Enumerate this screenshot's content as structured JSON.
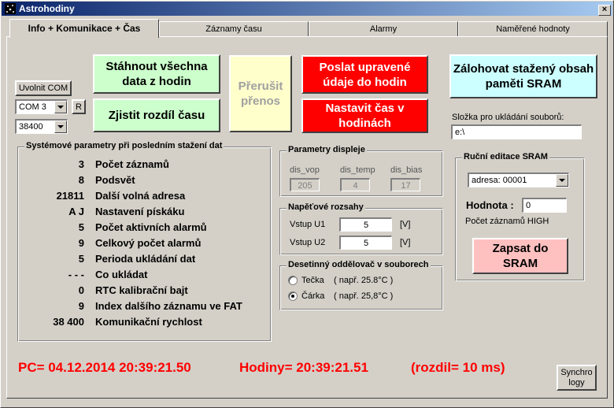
{
  "window": {
    "title": "Astrohodiny",
    "close_label": "×"
  },
  "tabs": [
    {
      "label": "Info + Komunikace + Čas",
      "active": true
    },
    {
      "label": "Záznamy času"
    },
    {
      "label": "Alarmy"
    },
    {
      "label": "Naměřené hodnoty"
    }
  ],
  "connection": {
    "release_label": "Uvolnit COM",
    "port_value": "COM 3",
    "refresh_label": "R",
    "baud_value": "38400"
  },
  "actions": {
    "download_label": "Stáhnout všechna data z hodin",
    "diff_label": "Zjistit rozdíl času",
    "abort_label": "Přerušit přenos",
    "send_label": "Poslat upravené údaje do hodin",
    "settime_label": "Nastavit čas v hodinách",
    "backup_label": "Zálohovat stažený obsah paměti SRAM",
    "write_label": "Zapsat do SRAM",
    "synchro_label": "Synchro logy"
  },
  "save_folder": {
    "label": "Složka pro ukládání souborů:",
    "value": "e:\\"
  },
  "system_params": {
    "title": "Systémové parametry při posledním stažení dat",
    "rows": [
      {
        "value": "3",
        "label": "Počet záznamů"
      },
      {
        "value": "8",
        "label": "Podsvět"
      },
      {
        "value": "21811",
        "label": "Další volná adresa"
      },
      {
        "value": "A J",
        "label": "Nastavení pískáku"
      },
      {
        "value": "5",
        "label": "Počet aktivních alarmů"
      },
      {
        "value": "9",
        "label": "Celkový počet alarmů"
      },
      {
        "value": "5",
        "label": "Perioda ukládání dat"
      },
      {
        "value": "- - -",
        "label": "Co ukládat"
      },
      {
        "value": "0",
        "label": "RTC kalibrační bajt"
      },
      {
        "value": "9",
        "label": "Index dalšího záznamu ve FAT"
      },
      {
        "value": "38 400",
        "label": "Komunikační rychlost"
      }
    ]
  },
  "display_params": {
    "title": "Parametry displeje",
    "vop_label": "dis_vop",
    "vop_value": "205",
    "temp_label": "dis_temp",
    "temp_value": "4",
    "bias_label": "dis_bias",
    "bias_value": "17"
  },
  "voltage": {
    "title": "Napěťové rozsahy",
    "u1_label": "Vstup U1",
    "u1_value": "5",
    "u1_unit": "[V]",
    "u2_label": "Vstup U2",
    "u2_value": "5",
    "u2_unit": "[V]"
  },
  "separator": {
    "title": "Desetinný oddělovač v souborech",
    "dot_label": "Tečka",
    "dot_example": "( např.  25.8°C )",
    "comma_label": "Čárka",
    "comma_example": "( např.  25,8°C )",
    "selected": "comma"
  },
  "sram_edit": {
    "title": "Ruční editace SRAM",
    "address_value": "adresa: 00001",
    "value_label": "Hodnota :",
    "value": "0",
    "description": "Počet záznamů HIGH"
  },
  "status": {
    "pc": "PC= 04.12.2014 20:39:21.50",
    "clock": "Hodiny= 20:39:21.51",
    "diff": "(rozdil= 10 ms)"
  },
  "colors": {
    "green": "#ccffcc",
    "yellow": "#ffffcc",
    "red": "#ff0000",
    "cyan": "#ccffff",
    "pink": "#ffc0c0",
    "status_red": "#ff0000"
  }
}
